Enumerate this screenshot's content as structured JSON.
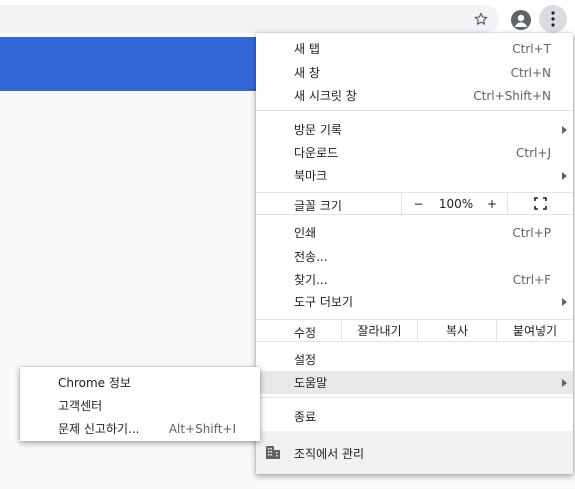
{
  "menu": {
    "new_tab": {
      "label": "새 탭",
      "shortcut": "Ctrl+T"
    },
    "new_window": {
      "label": "새 창",
      "shortcut": "Ctrl+N"
    },
    "incognito": {
      "label": "새 시크릿 창",
      "shortcut": "Ctrl+Shift+N"
    },
    "history": {
      "label": "방문 기록"
    },
    "downloads": {
      "label": "다운로드",
      "shortcut": "Ctrl+J"
    },
    "bookmarks": {
      "label": "북마크"
    },
    "zoom": {
      "label": "글꼴 크기",
      "minus": "−",
      "value": "100%",
      "plus": "+"
    },
    "print": {
      "label": "인쇄",
      "shortcut": "Ctrl+P"
    },
    "cast": {
      "label": "전송..."
    },
    "find": {
      "label": "찾기...",
      "shortcut": "Ctrl+F"
    },
    "more_tools": {
      "label": "도구 더보기"
    },
    "edit": {
      "label": "수정",
      "cut": "잘라내기",
      "copy": "복사",
      "paste": "붙여넣기"
    },
    "settings": {
      "label": "설정"
    },
    "help": {
      "label": "도움말"
    },
    "exit": {
      "label": "종료"
    },
    "managed": {
      "label": "조직에서 관리"
    }
  },
  "help_submenu": {
    "about": {
      "label": "Chrome 정보"
    },
    "help_center": {
      "label": "고객센터"
    },
    "report": {
      "label": "문제 신고하기...",
      "shortcut": "Alt+Shift+I"
    }
  },
  "colors": {
    "banner": "#3367d6",
    "highlight": "#e8e8e8"
  }
}
